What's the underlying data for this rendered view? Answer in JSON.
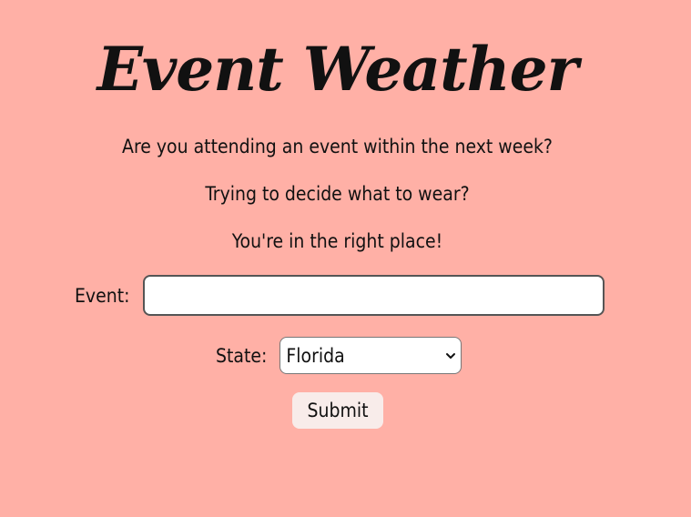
{
  "header": {
    "title": "Event Weather"
  },
  "intro": {
    "line1": "Are you attending an event within the next week?",
    "line2": "Trying to decide what to wear?",
    "line3": "You're in the right place!"
  },
  "form": {
    "event_label": "Event:",
    "event_value": "",
    "state_label": "State:",
    "state_selected": "Florida",
    "submit_label": "Submit"
  },
  "colors": {
    "background": "#ffb0a6",
    "button_background": "#f8ecea"
  }
}
